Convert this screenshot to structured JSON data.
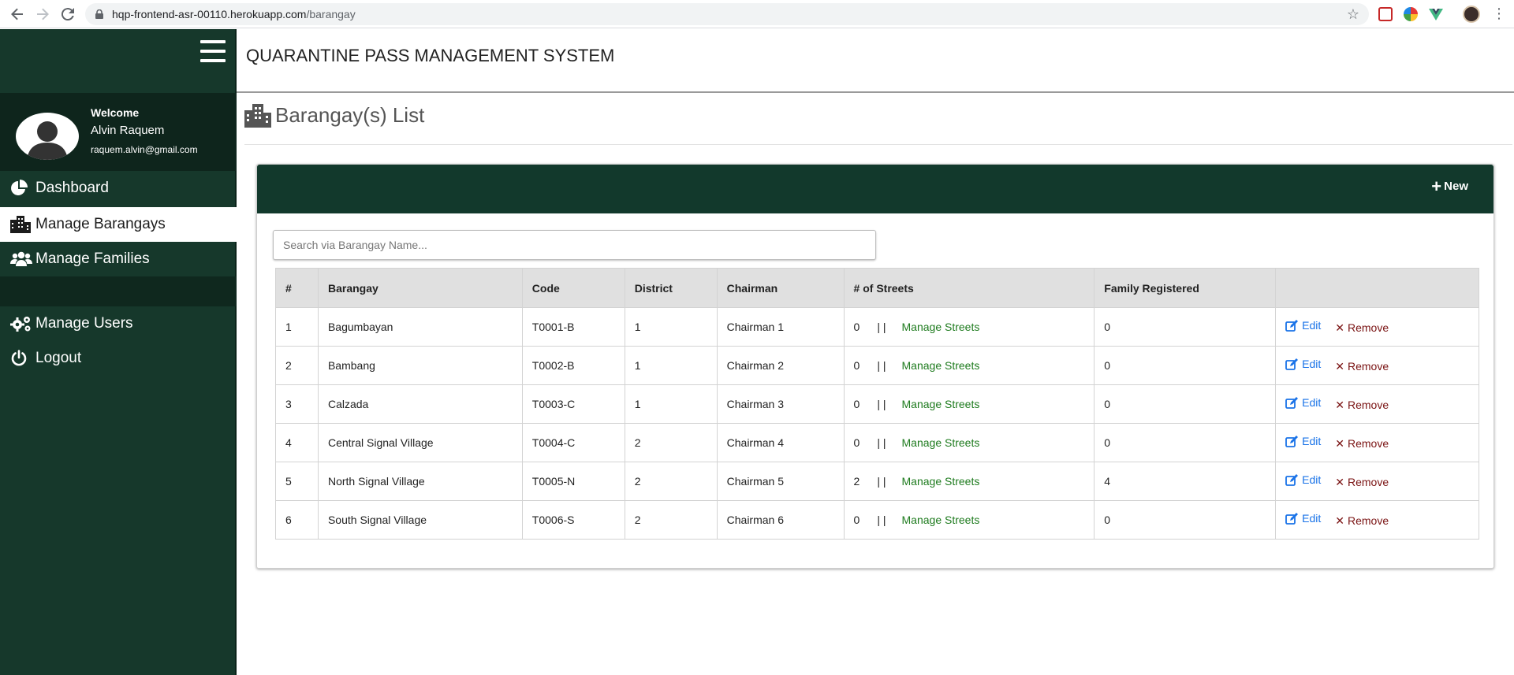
{
  "browser": {
    "url_host": "hqp-frontend-asr-00110.herokuapp.com",
    "url_path": "/barangay"
  },
  "sidebar": {
    "welcome": "Welcome",
    "user_name": "Alvin Raquem",
    "user_email": "raquem.alvin@gmail.com",
    "items": [
      {
        "label": "Dashboard",
        "icon": "pie-chart-icon"
      },
      {
        "label": "Manage Barangays",
        "icon": "building-icon",
        "active": true
      },
      {
        "label": "Manage Families",
        "icon": "users-icon"
      },
      {
        "label": "Manage Users",
        "icon": "gears-icon"
      },
      {
        "label": "Logout",
        "icon": "power-icon"
      }
    ]
  },
  "header": {
    "title": "QUARANTINE PASS MANAGEMENT SYSTEM"
  },
  "page": {
    "title": "Barangay(s) List",
    "new_label": "New",
    "search_placeholder": "Search via Barangay Name..."
  },
  "table": {
    "columns": [
      "#",
      "Barangay",
      "Code",
      "District",
      "Chairman",
      "# of Streets",
      "Family Registered",
      ""
    ],
    "separator": "| |",
    "manage_streets_label": "Manage Streets",
    "edit_label": "Edit",
    "remove_label": "Remove",
    "rows": [
      {
        "num": "1",
        "barangay": "Bagumbayan",
        "code": "T0001-B",
        "district": "1",
        "chairman": "Chairman 1",
        "streets": "0",
        "families": "0"
      },
      {
        "num": "2",
        "barangay": "Bambang",
        "code": "T0002-B",
        "district": "1",
        "chairman": "Chairman 2",
        "streets": "0",
        "families": "0"
      },
      {
        "num": "3",
        "barangay": "Calzada",
        "code": "T0003-C",
        "district": "1",
        "chairman": "Chairman 3",
        "streets": "0",
        "families": "0"
      },
      {
        "num": "4",
        "barangay": "Central Signal Village",
        "code": "T0004-C",
        "district": "2",
        "chairman": "Chairman 4",
        "streets": "0",
        "families": "0"
      },
      {
        "num": "5",
        "barangay": "North Signal Village",
        "code": "T0005-N",
        "district": "2",
        "chairman": "Chairman 5",
        "streets": "2",
        "families": "4"
      },
      {
        "num": "6",
        "barangay": "South Signal Village",
        "code": "T0006-S",
        "district": "2",
        "chairman": "Chairman 6",
        "streets": "0",
        "families": "0"
      }
    ]
  },
  "colors": {
    "sidebar_bg": "#16382b",
    "card_header_bg": "#12392c",
    "link_green": "#1e7b1e",
    "edit_blue": "#1a73e8",
    "remove_red": "#7a1313"
  }
}
